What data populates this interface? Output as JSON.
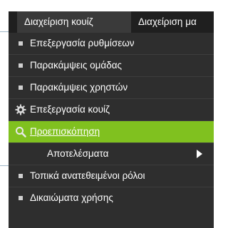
{
  "tabs": {
    "active_label": "Διαχείριση κουίζ",
    "second_label": "Διαχείριση μα"
  },
  "menu": {
    "items": [
      {
        "label": "Επεξεργασία ρυθμίσεων",
        "icon": "bullet"
      },
      {
        "label": "Παρακάμψεις ομάδας",
        "icon": "bullet"
      },
      {
        "label": "Παρακάμψεις χρηστών",
        "icon": "bullet"
      },
      {
        "label": "Επεξεργασία κουίζ",
        "icon": "gear-icon"
      },
      {
        "label": "Προεπισκόπηση",
        "icon": "search-icon",
        "highlighted": true
      },
      {
        "label": "Αποτελέσματα",
        "icon": "chevron-right-icon",
        "submenu": true
      },
      {
        "label": "Τοπικά ανατεθειμένοι ρόλοι",
        "icon": "bullet"
      },
      {
        "label": "Δικαιώματα χρήσης",
        "icon": "bullet"
      }
    ]
  },
  "colors": {
    "menu_bg": "#2e2e2e",
    "tab_bg": "#1f1f1f",
    "active_tab_bg": "#3a3a3a",
    "highlight": "#80c11f",
    "text": "#ffffff"
  }
}
